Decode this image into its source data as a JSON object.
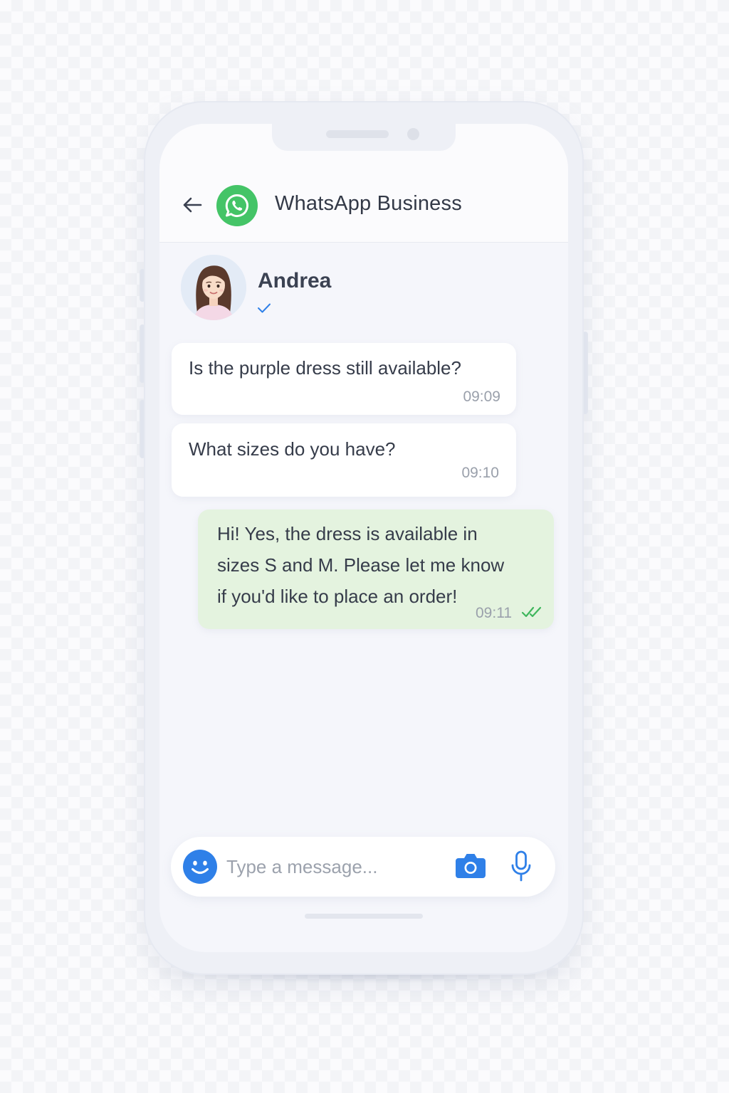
{
  "header": {
    "back_icon": "arrow-left-icon",
    "logo_icon": "whatsapp-icon",
    "title": "WhatsApp Business"
  },
  "contact": {
    "name": "Andrea",
    "status_icon": "single-check-icon"
  },
  "messages": [
    {
      "direction": "incoming",
      "text": "Is the purple dress still available?",
      "time": "09:09"
    },
    {
      "direction": "incoming",
      "text": "What sizes do you have?",
      "time": "09:10"
    },
    {
      "direction": "outgoing",
      "lines": [
        "Hi! Yes, the dress is available in",
        "sizes S and M. Please let me know",
        "if you'd like to place an order!"
      ],
      "time": "09:11",
      "status_icon": "double-check-icon"
    }
  ],
  "composer": {
    "placeholder": "Type a message...",
    "emoji_icon": "smiley-icon",
    "camera_icon": "camera-icon",
    "mic_icon": "microphone-icon"
  },
  "colors": {
    "whatsapp_green": "#44c467",
    "outgoing_bubble": "#e4f3df",
    "accent_blue": "#2f80e8",
    "read_check": "#3fb65c"
  }
}
